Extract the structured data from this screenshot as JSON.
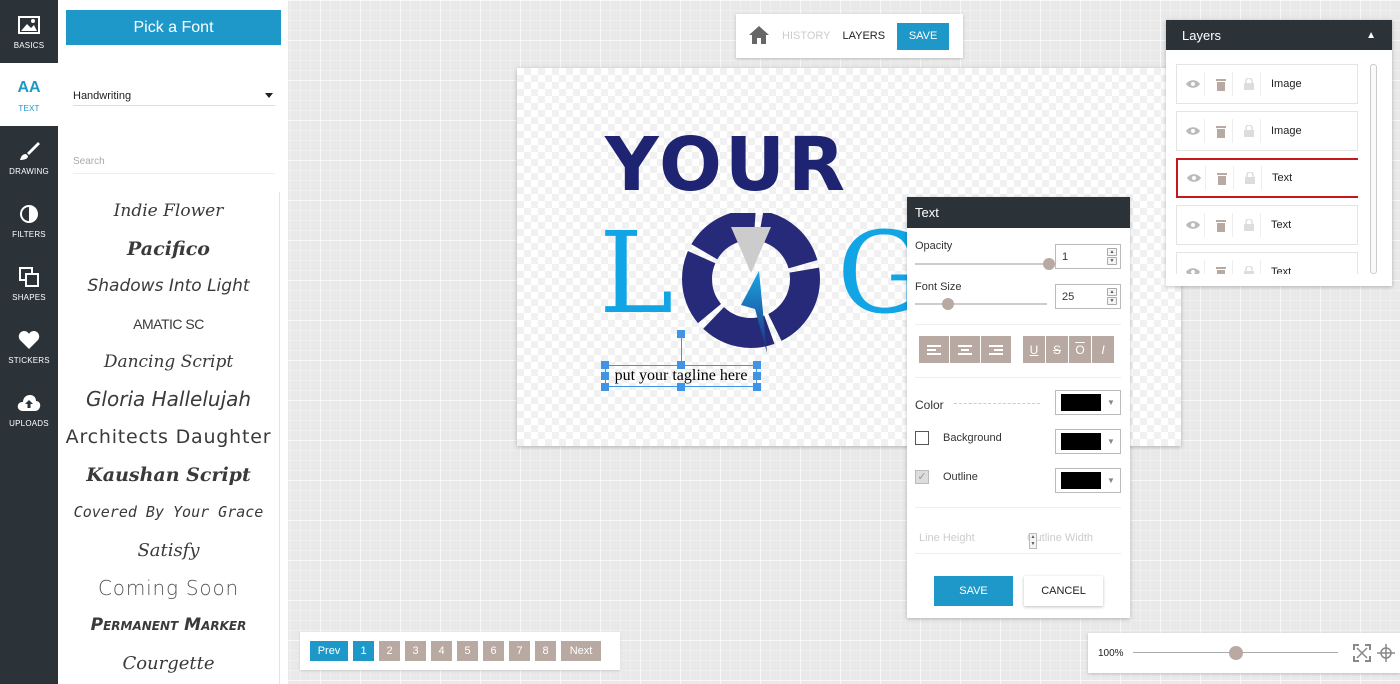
{
  "rail": {
    "items": [
      {
        "label": "BASICS",
        "icon": "image-icon"
      },
      {
        "label": "TEXT",
        "icon": "text-icon",
        "icon_text": "AA"
      },
      {
        "label": "DRAWING",
        "icon": "brush-icon"
      },
      {
        "label": "FILTERS",
        "icon": "filter-icon"
      },
      {
        "label": "SHAPES",
        "icon": "shapes-icon"
      },
      {
        "label": "STICKERS",
        "icon": "heart-icon"
      },
      {
        "label": "UPLOADS",
        "icon": "cloud-upload-icon"
      }
    ]
  },
  "font_panel": {
    "pick_font_label": "Pick a Font",
    "category_value": "Handwriting",
    "search_placeholder": "Search",
    "fonts": [
      "Indie Flower",
      "Pacifico",
      "Shadows Into Light",
      "AMATIC SC",
      "Dancing Script",
      "Gloria Hallelujah",
      "Architects Daughter",
      "Kaushan Script",
      "Covered By Your Grace",
      "Satisfy",
      "Coming Soon",
      "Permanent Marker",
      "Courgette"
    ]
  },
  "pagination": {
    "prev_label": "Prev",
    "next_label": "Next",
    "pages": [
      "1",
      "2",
      "3",
      "4",
      "5",
      "6",
      "7",
      "8"
    ],
    "current_page": "1"
  },
  "toolbar": {
    "history_label": "HISTORY",
    "layers_label": "LAYERS",
    "save_label": "SAVE"
  },
  "canvas": {
    "logo_your": "YOUR",
    "logo_l": "L",
    "logo_g": "G",
    "tagline": "put your tagline here"
  },
  "text_panel": {
    "title": "Text",
    "opacity_label": "Opacity",
    "opacity_value": "1",
    "opacity_level": 1.0,
    "font_size_label": "Font Size",
    "font_size_value": "25",
    "font_size_level": 0.25,
    "align_buttons": [
      "align-left-icon",
      "align-center-icon",
      "align-right-icon"
    ],
    "style_buttons": [
      {
        "label": "U",
        "name": "underline"
      },
      {
        "label": "S",
        "name": "strikethrough"
      },
      {
        "label": "O",
        "name": "overline"
      },
      {
        "label": "I",
        "name": "italic"
      }
    ],
    "color_label": "Color",
    "background_label": "Background",
    "outline_label": "Outline",
    "line_height_label": "Line Height",
    "outline_width_label": "Outline Width",
    "save_label": "SAVE",
    "cancel_label": "CANCEL",
    "colors": {
      "color": "#000000",
      "background": "#000000",
      "outline": "#000000"
    }
  },
  "layers_panel": {
    "title": "Layers",
    "layers": [
      {
        "name": "Image",
        "selected": false
      },
      {
        "name": "Image",
        "selected": false
      },
      {
        "name": "Text",
        "selected": true
      },
      {
        "name": "Text",
        "selected": false
      },
      {
        "name": "Text",
        "selected": false
      }
    ]
  },
  "zoom": {
    "label": "100%",
    "level": 0.5
  },
  "colors": {
    "accent": "#1e98c9",
    "dark": "#2b3338",
    "muted_button": "#b8a9a2",
    "logo_navy": "#1e2472",
    "logo_cyan": "#12a5e6",
    "selection_red": "#c8161d"
  }
}
